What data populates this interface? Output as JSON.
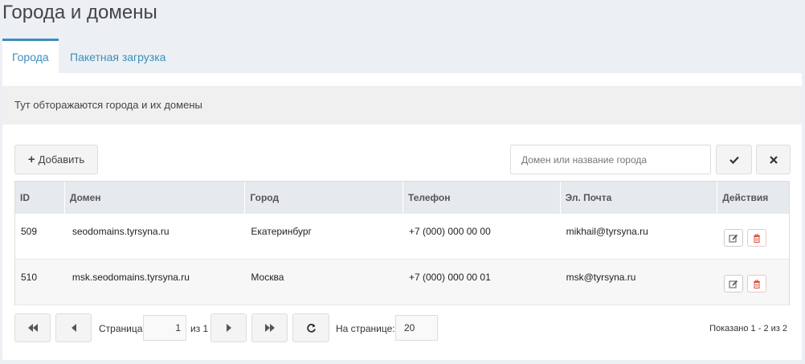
{
  "page": {
    "title": "Города и домены"
  },
  "tabs": [
    {
      "label": "Города",
      "active": true
    },
    {
      "label": "Пакетная загрузка",
      "active": false
    }
  ],
  "info": {
    "text": "Тут обторажаются города и их домены"
  },
  "toolbar": {
    "add_label": "Добавить",
    "search_placeholder": "Домен или название города"
  },
  "table": {
    "columns": [
      "ID",
      "Домен",
      "Город",
      "Телефон",
      "Эл. Почта",
      "Действия"
    ],
    "rows": [
      {
        "id": "509",
        "domain": "seodomains.tyrsyna.ru",
        "city": "Екатеринбург",
        "phone": "+7 (000) 000 00 00",
        "email": "mikhail@tyrsyna.ru"
      },
      {
        "id": "510",
        "domain": "msk.seodomains.tyrsyna.ru",
        "city": "Москва",
        "phone": "+7 (000) 000 00 01",
        "email": "msk@tyrsyna.ru"
      }
    ]
  },
  "pager": {
    "page_label": "Страница",
    "current_page": "1",
    "of_label": "из 1",
    "per_page_label": "На странице:",
    "per_page": "20",
    "summary": "Показано 1 - 2 из 2"
  },
  "colors": {
    "accent": "#3c8dbc",
    "delete": "#dd4b39"
  }
}
